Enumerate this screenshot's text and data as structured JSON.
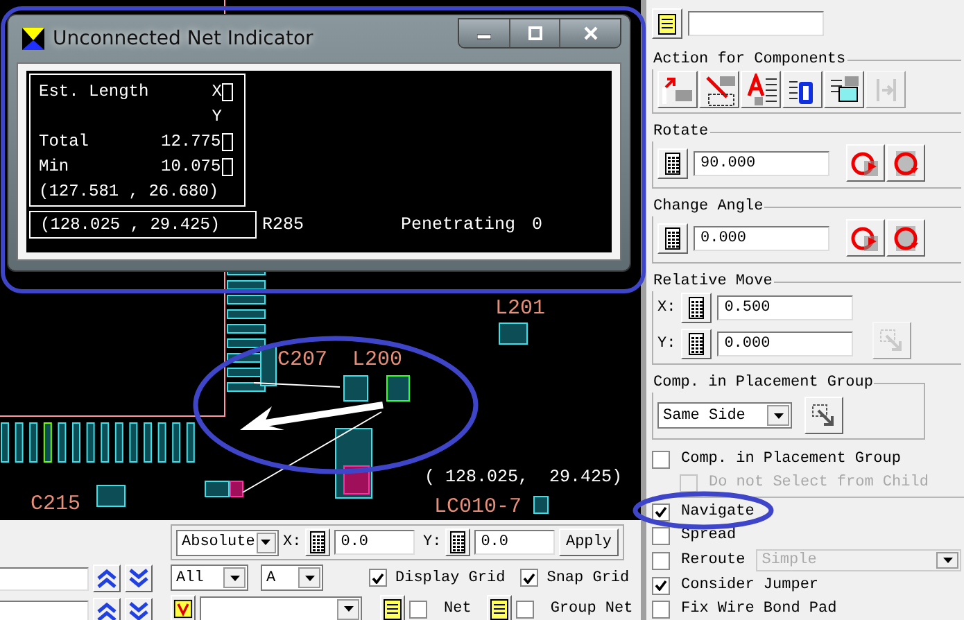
{
  "pcb_canvas": {
    "labels": [
      {
        "text": "L201"
      },
      {
        "text": "C207"
      },
      {
        "text": "L200"
      },
      {
        "text": "C215"
      },
      {
        "text": "LC010-7"
      }
    ],
    "coordinate_readout": "( 128.025,  29.425)"
  },
  "dialog": {
    "title": "Unconnected Net Indicator",
    "est_length_label": "Est. Length",
    "x_label": "X",
    "y_label": "Y",
    "total_label": "Total",
    "total_value": "12.775",
    "min_label": "Min",
    "min_value": "10.075",
    "point_a": "(127.581 , 26.680)",
    "point_b": "(128.025 , 29.425)",
    "component": "R285",
    "penetrating_label": "Penetrating",
    "penetrating_value": "0"
  },
  "right_panel": {
    "action_group": {
      "title": "Action for Components",
      "buttons": [
        {
          "disabled": false
        },
        {
          "disabled": false
        },
        {
          "disabled": false
        },
        {
          "disabled": false
        },
        {
          "disabled": false
        },
        {
          "disabled": true
        }
      ]
    },
    "rotate": {
      "title": "Rotate",
      "value": "90.000"
    },
    "change_angle": {
      "title": "Change Angle",
      "value": "0.000"
    },
    "relative_move": {
      "title": "Relative Move",
      "x_label": "X:",
      "x_value": "0.500",
      "y_label": "Y:",
      "y_value": "0.000",
      "apply_disabled": true
    },
    "placement_group": {
      "title": "Comp. in Placement Group",
      "mode": "Same Side"
    },
    "options": [
      {
        "label": "Comp. in Placement Group",
        "checked": false,
        "disabled": false,
        "children": [
          {
            "label": "Do not Select from Child",
            "checked": false,
            "disabled": true
          }
        ]
      },
      {
        "label": "Navigate",
        "checked": true,
        "disabled": false
      },
      {
        "label": "Spread",
        "checked": false,
        "disabled": false
      },
      {
        "label": "Reroute",
        "checked": false,
        "disabled": false,
        "select": {
          "value": "Simple",
          "disabled": true
        }
      },
      {
        "label": "Consider Jumper",
        "checked": true,
        "disabled": false
      },
      {
        "label": "Fix Wire Bond Pad",
        "checked": false,
        "disabled": false
      }
    ]
  },
  "bottom_bar": {
    "move": {
      "mode": "Absolute",
      "x_label": "X:",
      "x_value": "0.0",
      "y_label": "Y:",
      "y_value": "0.0",
      "apply": "Apply"
    },
    "filters": [
      {
        "value": "All"
      },
      {
        "value": "A"
      }
    ],
    "grid_checks": [
      {
        "label": "Display Grid",
        "checked": true
      },
      {
        "label": "Snap Grid",
        "checked": true
      }
    ],
    "net_checks": [
      {
        "label": "Net",
        "checked": false
      },
      {
        "label": "Group Net",
        "checked": false
      }
    ]
  }
}
